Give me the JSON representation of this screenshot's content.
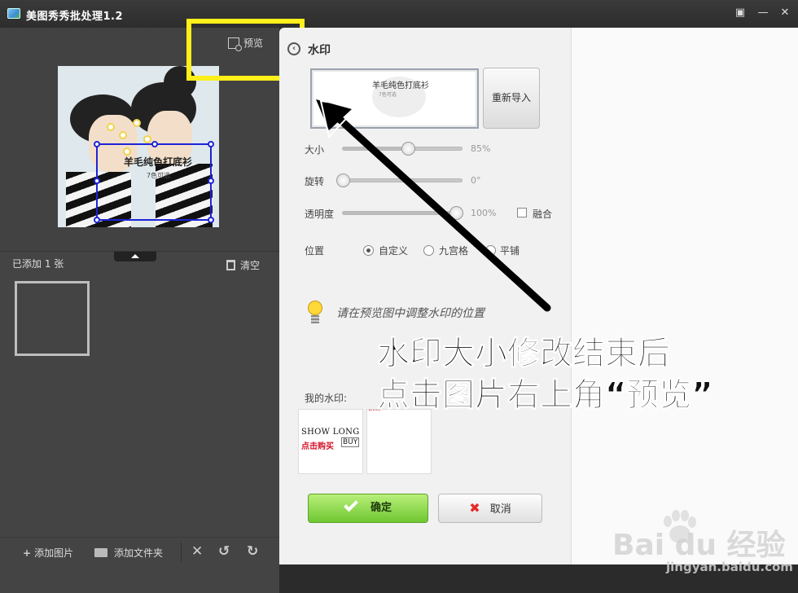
{
  "window": {
    "title": "美图秀秀批处理1.2"
  },
  "left": {
    "preview_label": "预览",
    "added_count": "已添加 1 张",
    "clear_label": "清空",
    "bottom": {
      "add_image": "添加图片",
      "add_folder": "添加文件夹"
    },
    "photo_watermark": {
      "title": "羊毛纯色打底衫",
      "subtitle": "7色可选"
    }
  },
  "settings": {
    "title": "水印",
    "watermark_preview": {
      "title": "羊毛纯色打底衫",
      "subtitle": "7色可选"
    },
    "reimport_label": "重新导入",
    "size": {
      "label": "大小",
      "value": "85%",
      "level": 0.55
    },
    "rotate": {
      "label": "旋转",
      "value": "0°",
      "level": 0.0
    },
    "opacity": {
      "label": "透明度",
      "value": "100%",
      "level": 0.95
    },
    "blend_label": "融合",
    "position": {
      "label": "位置",
      "options": [
        "自定义",
        "九宫格",
        "平铺"
      ],
      "selected": "自定义"
    },
    "hint": "请在预览图中调整水印的位置",
    "my_watermarks_label": "我的水印:",
    "my_watermark_1": {
      "line1": "SHOW  LONG",
      "line2": "点击购买",
      "buy": "BUY"
    },
    "ok_label": "确定",
    "cancel_label": "取消"
  },
  "annotation": {
    "line1": "水印大小修改结束后",
    "line2": "点击图片右上角“预览”"
  },
  "watermark": {
    "brand": "Bai du 经验",
    "url": "jingyan.baidu.com"
  },
  "colors": {
    "highlight": "#ffef1a",
    "ok_green": "#6fc632",
    "selection_blue": "#1d24d6"
  }
}
